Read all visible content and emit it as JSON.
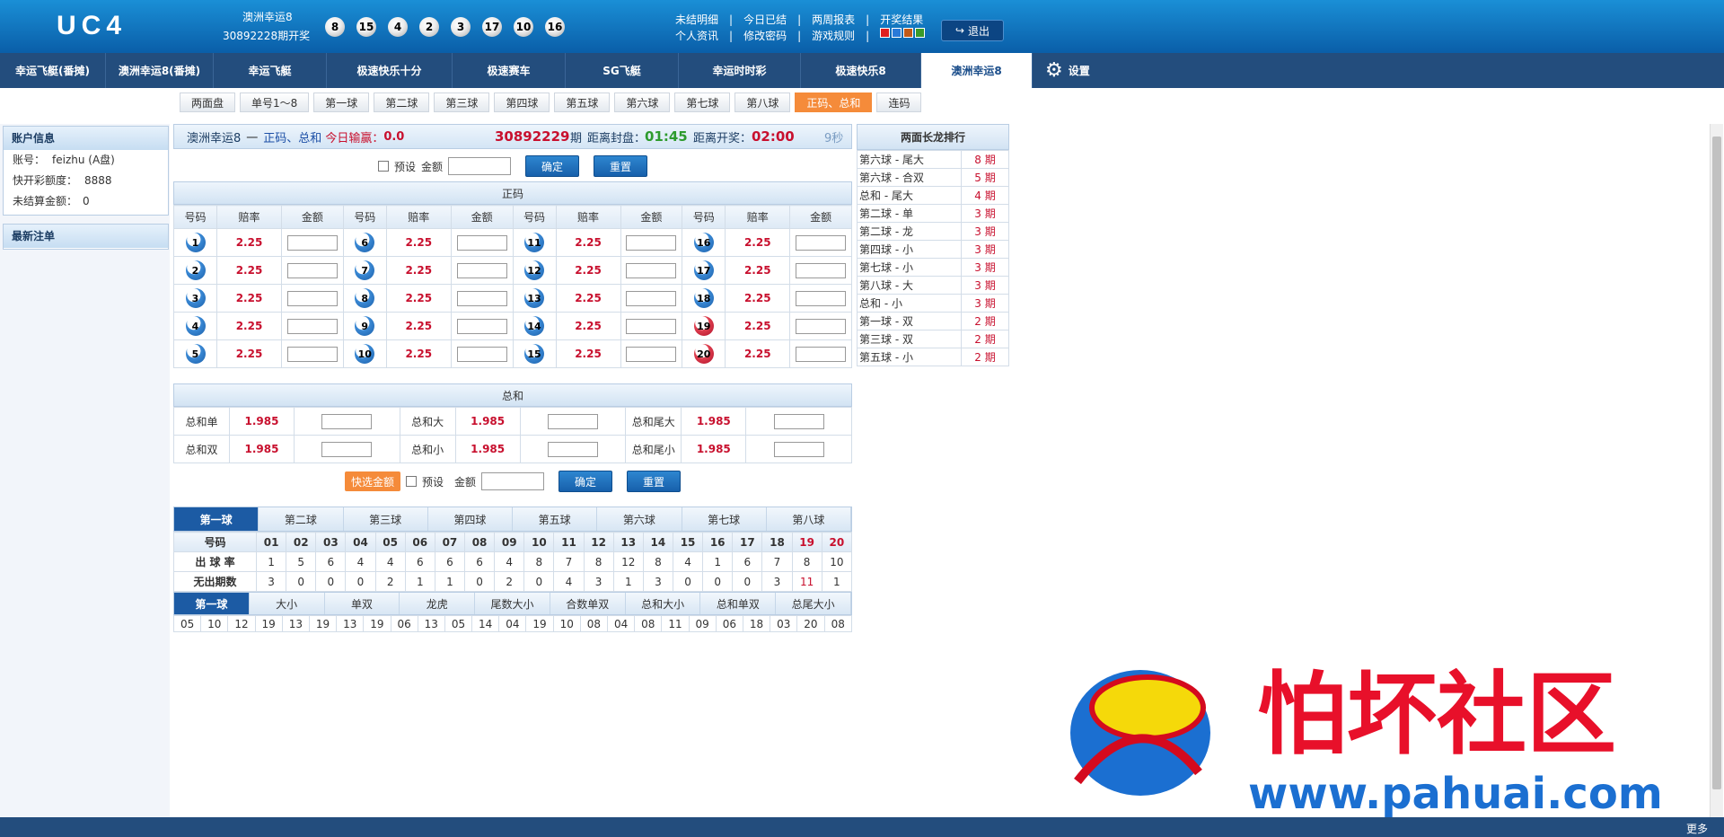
{
  "header": {
    "logo": "UC4",
    "draw_name": "澳洲幸运8",
    "draw_period": "30892228期开奖",
    "draw_balls": [
      "8",
      "15",
      "4",
      "2",
      "3",
      "17",
      "10",
      "16"
    ],
    "links_row1": [
      "未结明细",
      "今日已结",
      "两周报表",
      "开奖结果"
    ],
    "links_row2": [
      "个人资讯",
      "修改密码",
      "游戏规则"
    ],
    "swatch_colors": [
      "#e02020",
      "#2a7ad8",
      "#c05a18",
      "#3a9a2a"
    ],
    "logout_label": "退出"
  },
  "nav": {
    "items": [
      "幸运飞艇(番摊)",
      "澳洲幸运8(番摊)",
      "幸运飞艇",
      "极速快乐十分",
      "极速赛车",
      "SG飞艇",
      "幸运时时彩",
      "极速快乐8",
      "澳洲幸运8"
    ],
    "active": "澳洲幸运8",
    "settings_label": "设置"
  },
  "subnav": {
    "tabs": [
      "两面盘",
      "单号1～8",
      "第一球",
      "第二球",
      "第三球",
      "第四球",
      "第五球",
      "第六球",
      "第七球",
      "第八球",
      "正码、总和",
      "连码"
    ],
    "active": "正码、总和"
  },
  "left": {
    "account_title": "账户信息",
    "account_label": "账号：",
    "account_value": "feizhu (A盘)",
    "credit_label": "快开彩额度：",
    "credit_value": "8888",
    "unsettled_label": "未结算金额：",
    "unsettled_value": "0",
    "recent_title": "最新注单"
  },
  "main": {
    "game": "澳洲幸运8",
    "dash": "一",
    "play": "正码、总和",
    "winloss_label": "今日输赢：",
    "winloss": "0.0",
    "period": "30892229",
    "period_suffix": "期",
    "close_label": "距离封盘：",
    "close_time": "01:45",
    "open_label": "距离开奖：",
    "open_time": "02:00",
    "refresh": "9秒",
    "preset_label": "预设",
    "amount_label": "金额",
    "confirm": "确定",
    "reset": "重置",
    "quick_amount": "快选金额",
    "zhengma_title": "正码",
    "col_headers": [
      "号码",
      "赔率",
      "金额"
    ],
    "zhengma_rows": [
      [
        [
          "1",
          "2.25"
        ],
        [
          "6",
          "2.25"
        ],
        [
          "11",
          "2.25"
        ],
        [
          "16",
          "2.25"
        ]
      ],
      [
        [
          "2",
          "2.25"
        ],
        [
          "7",
          "2.25"
        ],
        [
          "12",
          "2.25"
        ],
        [
          "17",
          "2.25"
        ]
      ],
      [
        [
          "3",
          "2.25"
        ],
        [
          "8",
          "2.25"
        ],
        [
          "13",
          "2.25"
        ],
        [
          "18",
          "2.25"
        ]
      ],
      [
        [
          "4",
          "2.25"
        ],
        [
          "9",
          "2.25"
        ],
        [
          "14",
          "2.25"
        ],
        [
          "19",
          "2.25"
        ]
      ],
      [
        [
          "5",
          "2.25"
        ],
        [
          "10",
          "2.25"
        ],
        [
          "15",
          "2.25"
        ],
        [
          "20",
          "2.25"
        ]
      ]
    ],
    "zonghe_title": "总和",
    "zonghe_rows": [
      [
        [
          "总和单",
          "1.985"
        ],
        [
          "总和大",
          "1.985"
        ],
        [
          "总和尾大",
          "1.985"
        ]
      ],
      [
        [
          "总和双",
          "1.985"
        ],
        [
          "总和小",
          "1.985"
        ],
        [
          "总和尾小",
          "1.985"
        ]
      ]
    ]
  },
  "stats": {
    "ball_tabs": [
      "第一球",
      "第二球",
      "第三球",
      "第四球",
      "第五球",
      "第六球",
      "第七球",
      "第八球"
    ],
    "active_ball": "第一球",
    "number_label": "号码",
    "numbers": [
      "01",
      "02",
      "03",
      "04",
      "05",
      "06",
      "07",
      "08",
      "09",
      "10",
      "11",
      "12",
      "13",
      "14",
      "15",
      "16",
      "17",
      "18",
      "19",
      "20"
    ],
    "rate_label": "出 球 率",
    "rates": [
      "1",
      "5",
      "6",
      "4",
      "4",
      "6",
      "6",
      "6",
      "4",
      "8",
      "7",
      "8",
      "12",
      "8",
      "4",
      "1",
      "6",
      "7",
      "8",
      "10"
    ],
    "miss_label": "无出期数",
    "misses": [
      "3",
      "0",
      "0",
      "0",
      "2",
      "1",
      "1",
      "0",
      "2",
      "0",
      "4",
      "3",
      "1",
      "3",
      "0",
      "0",
      "0",
      "3",
      "11",
      "1"
    ],
    "type_tabs": [
      "第一球",
      "大小",
      "单双",
      "龙虎",
      "尾数大小",
      "合数单双",
      "总和大小",
      "总和单双",
      "总尾大小"
    ],
    "active_type": "第一球",
    "history": [
      "05",
      "10",
      "12",
      "19",
      "13",
      "19",
      "13",
      "19",
      "06",
      "13",
      "05",
      "14",
      "04",
      "19",
      "10",
      "08",
      "04",
      "08",
      "11",
      "09",
      "06",
      "18",
      "03",
      "20",
      "08"
    ]
  },
  "ranking": {
    "title": "两面长龙排行",
    "rows": [
      [
        "第六球 - 尾大",
        "8 期"
      ],
      [
        "第六球 - 合双",
        "5 期"
      ],
      [
        "总和 - 尾大",
        "4 期"
      ],
      [
        "第二球 - 单",
        "3 期"
      ],
      [
        "第二球 - 龙",
        "3 期"
      ],
      [
        "第四球 - 小",
        "3 期"
      ],
      [
        "第七球 - 小",
        "3 期"
      ],
      [
        "第八球 - 大",
        "3 期"
      ],
      [
        "总和 - 小",
        "3 期"
      ],
      [
        "第一球 - 双",
        "2 期"
      ],
      [
        "第三球 - 双",
        "2 期"
      ],
      [
        "第五球 - 小",
        "2 期"
      ]
    ]
  },
  "footer": {
    "more": "更多"
  },
  "watermark": {
    "text": "怕坏社区",
    "url": "www.pahuai.com"
  }
}
